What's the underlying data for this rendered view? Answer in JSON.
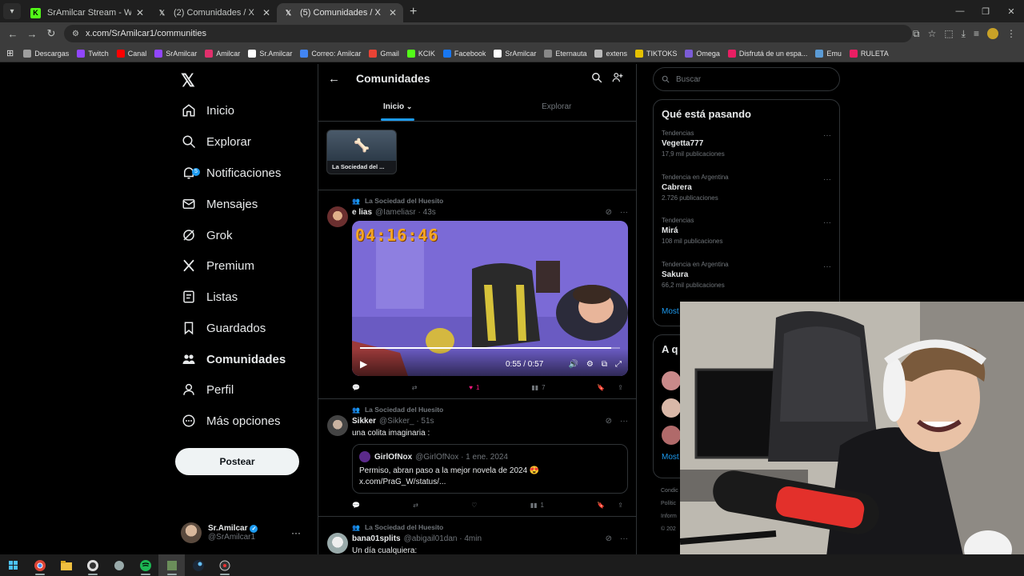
{
  "browser": {
    "tabs": [
      {
        "title": "SrAmilcar Stream - Watch Live o",
        "favicon": "kick-icon",
        "color": "#53fc18"
      },
      {
        "title": "(2) Comunidades / X",
        "favicon": "x-icon",
        "color": "#ffffff"
      },
      {
        "title": "(5) Comunidades / X",
        "favicon": "x-icon",
        "color": "#ffffff"
      }
    ],
    "url": "x.com/SrAmilcar1/communities",
    "bookmarks": [
      "Descargas",
      "Twitch",
      "Canal",
      "SrAmilcar",
      "Amilcar",
      "Sr.Amilcar",
      "Correo: Amilcar",
      "Gmail",
      "KCIK",
      "Facebook",
      "SrAmilcar",
      "Eternauta",
      "extens",
      "TIKTOKS",
      "Omega",
      "Disfrutá de un espa...",
      "Emu",
      "RULETA"
    ],
    "bookmark_colors": [
      "#9e9e9e",
      "#9146ff",
      "#ff0000",
      "#9146ff",
      "#e1306c",
      "#ffffff",
      "#4285f4",
      "#ea4335",
      "#53fc18",
      "#1877f2",
      "#ffffff",
      "#888888",
      "#bbbbbb",
      "#e5c100",
      "#7b5cd6",
      "#e91e63",
      "#5b9bd5",
      "#e91e63"
    ]
  },
  "nav": {
    "items": [
      {
        "label": "Inicio",
        "icon": "home-icon"
      },
      {
        "label": "Explorar",
        "icon": "search-icon"
      },
      {
        "label": "Notificaciones",
        "icon": "bell-icon",
        "badge": "5"
      },
      {
        "label": "Mensajes",
        "icon": "mail-icon"
      },
      {
        "label": "Grok",
        "icon": "grok-icon"
      },
      {
        "label": "Premium",
        "icon": "x-icon"
      },
      {
        "label": "Listas",
        "icon": "list-icon"
      },
      {
        "label": "Guardados",
        "icon": "bookmark-icon"
      },
      {
        "label": "Comunidades",
        "icon": "communities-icon",
        "active": true
      },
      {
        "label": "Perfil",
        "icon": "person-icon"
      },
      {
        "label": "Más opciones",
        "icon": "more-circle-icon"
      }
    ],
    "post_button": "Postear",
    "account": {
      "name": "Sr.Amilcar",
      "handle": "@SrAmilcar1"
    }
  },
  "center": {
    "title": "Comunidades",
    "tabs": [
      "Inicio",
      "Explorar"
    ],
    "community_card": "La Sociedad del ...",
    "tweets": [
      {
        "context": "La Sociedad del Huesito",
        "name": "e lias",
        "handle": "@Iameliasr",
        "time": "· 43s",
        "video": {
          "timer": "04:16:46",
          "time": "0:55 / 0:57",
          "progress": 0.965
        },
        "actions": {
          "reply": "",
          "retweet": "",
          "like": "1",
          "views": "7"
        },
        "liked": true
      },
      {
        "context": "La Sociedad del Huesito",
        "name": "Sikker",
        "handle": "@Sikker_",
        "time": "· 51s",
        "text": "una colita imaginaria :",
        "quote": {
          "name": "GirlOfNox",
          "handle": "@GirlOfNox",
          "time": "· 1 ene. 2024",
          "line1": "Permiso, abran paso a la mejor novela de 2024 😍",
          "line2": "x.com/PraG_W/status/..."
        },
        "actions": {
          "reply": "",
          "retweet": "",
          "like": "",
          "views": "1"
        },
        "liked": false
      },
      {
        "context": "La Sociedad del Huesito",
        "name": "bana01splits",
        "handle": "@abigail01dan",
        "time": "· 4min",
        "text": "Un día cualquiera:"
      }
    ]
  },
  "right": {
    "search_placeholder": "Buscar",
    "trends_title": "Qué está pasando",
    "trends": [
      {
        "category": "Tendencias",
        "name": "Vegetta777",
        "count": "17,9 mil publicaciones"
      },
      {
        "category": "Tendencia en Argentina",
        "name": "Cabrera",
        "count": "2.726 publicaciones"
      },
      {
        "category": "Tendencias",
        "name": "Mirá",
        "count": "108 mil publicaciones"
      },
      {
        "category": "Tendencia en Argentina",
        "name": "Sakura",
        "count": "66,2 mil publicaciones"
      }
    ],
    "show_more": "Most",
    "who_title": "A q",
    "show_more2": "Most",
    "footer": [
      "Condic",
      "Polític",
      "Inform",
      "© 202"
    ]
  }
}
